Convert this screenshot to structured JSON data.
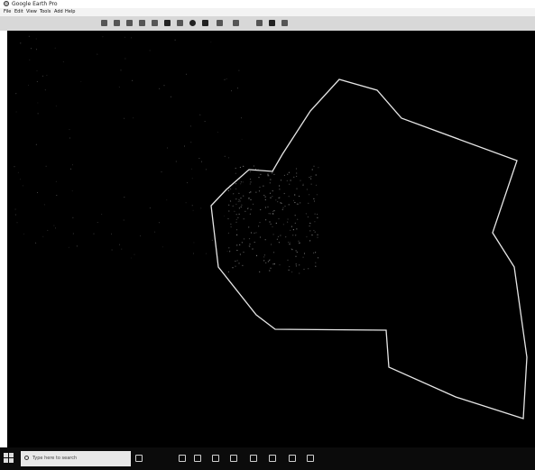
{
  "window": {
    "title": "Google Earth Pro",
    "app_icon": "google-earth-icon"
  },
  "menu": {
    "items": [
      "File",
      "Edit",
      "View",
      "Tools",
      "Add",
      "Help"
    ]
  },
  "toolbar": {
    "icons": [
      "hide-sidebar-icon",
      "placemark-icon",
      "polygon-icon",
      "path-icon",
      "image-overlay-icon",
      "record-tour-icon",
      "historical-imagery-icon",
      "sun-icon",
      "planets-icon",
      "ruler-icon",
      "email-icon",
      "print-icon",
      "save-image-icon",
      "view-in-maps-icon"
    ]
  },
  "map": {
    "background": "#000000",
    "polygon_color": "#e6e6e6",
    "city_lights_color": "#8a8a8a"
  },
  "taskbar": {
    "search_placeholder": "Type here to search",
    "icons": [
      "task-view-icon",
      "file-explorer-icon",
      "store-icon",
      "edge-icon",
      "mail-icon",
      "settings-icon",
      "photos-icon",
      "google-earth-taskbar-icon"
    ]
  }
}
